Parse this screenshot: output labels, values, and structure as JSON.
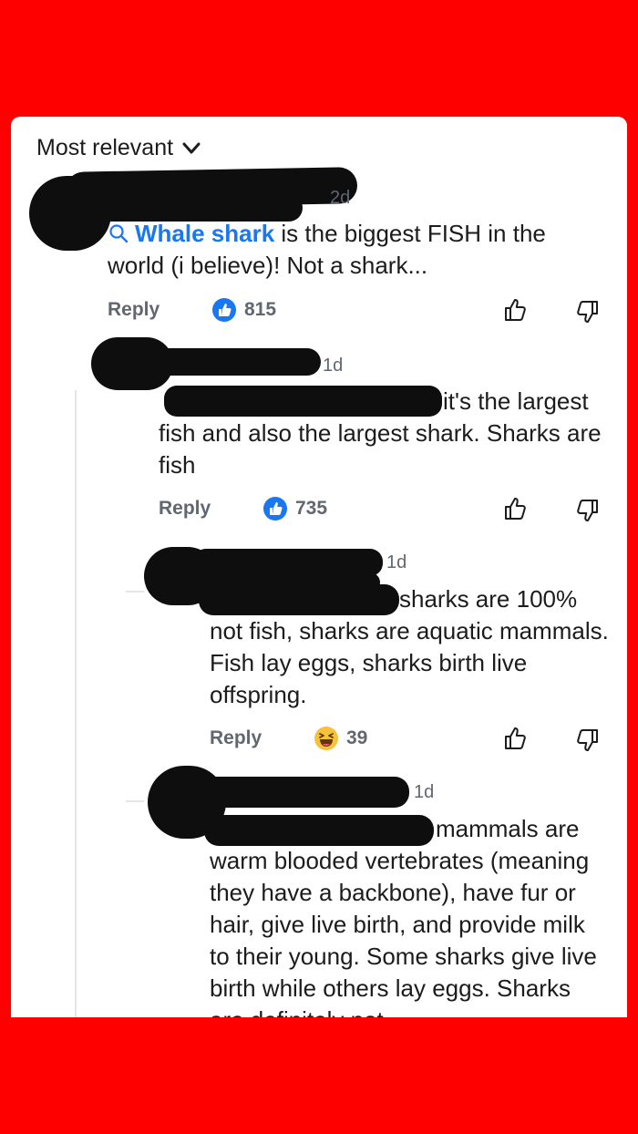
{
  "header": {
    "sort_label": "Most relevant"
  },
  "comments": [
    {
      "timestamp": "2d",
      "keyword": "Whale shark",
      "text": " is the biggest FISH in the world (i believe)! Not a shark...",
      "reply_label": "Reply",
      "reaction": {
        "type": "like",
        "count": "815"
      }
    },
    {
      "timestamp": "1d",
      "text": "it's the largest fish and also the largest shark. Sharks are fish",
      "reply_label": "Reply",
      "reaction": {
        "type": "like",
        "count": "735"
      }
    },
    {
      "timestamp": "1d",
      "text": "sharks are 100% not fish, sharks are aquatic mammals. Fish lay eggs, sharks birth live offspring.",
      "reply_label": "Reply",
      "reaction": {
        "type": "haha",
        "count": "39"
      }
    },
    {
      "timestamp": "1d",
      "text": "mammals are warm blooded vertebrates (meaning they have a backbone), have fur or hair, give live birth, and provide milk to their young. Some sharks give live birth while others lay eggs. Sharks are definitely not"
    }
  ],
  "colors": {
    "background": "#fe0000",
    "card": "#ffffff",
    "link": "#1877f2",
    "muted": "#606770"
  },
  "icons": [
    "chevron-down-icon",
    "search-icon",
    "like-reaction-icon",
    "haha-reaction-icon",
    "thumbs-up-icon",
    "thumbs-down-icon"
  ]
}
